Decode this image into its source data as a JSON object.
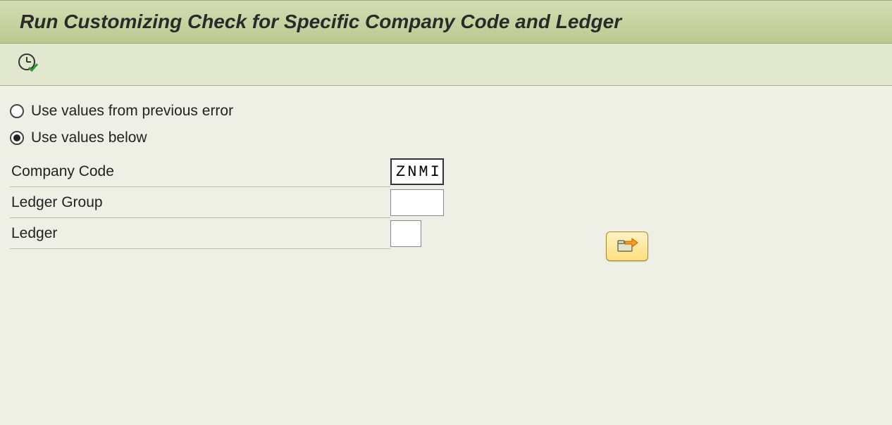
{
  "header": {
    "title": "Run Customizing Check for Specific Company Code and Ledger"
  },
  "options": {
    "radio1_label": "Use values from previous error",
    "radio2_label": "Use values below",
    "selected": "below"
  },
  "fields": {
    "company_code": {
      "label": "Company Code",
      "value": "ZNMI"
    },
    "ledger_group": {
      "label": "Ledger Group",
      "value": ""
    },
    "ledger": {
      "label": "Ledger",
      "value": ""
    }
  }
}
